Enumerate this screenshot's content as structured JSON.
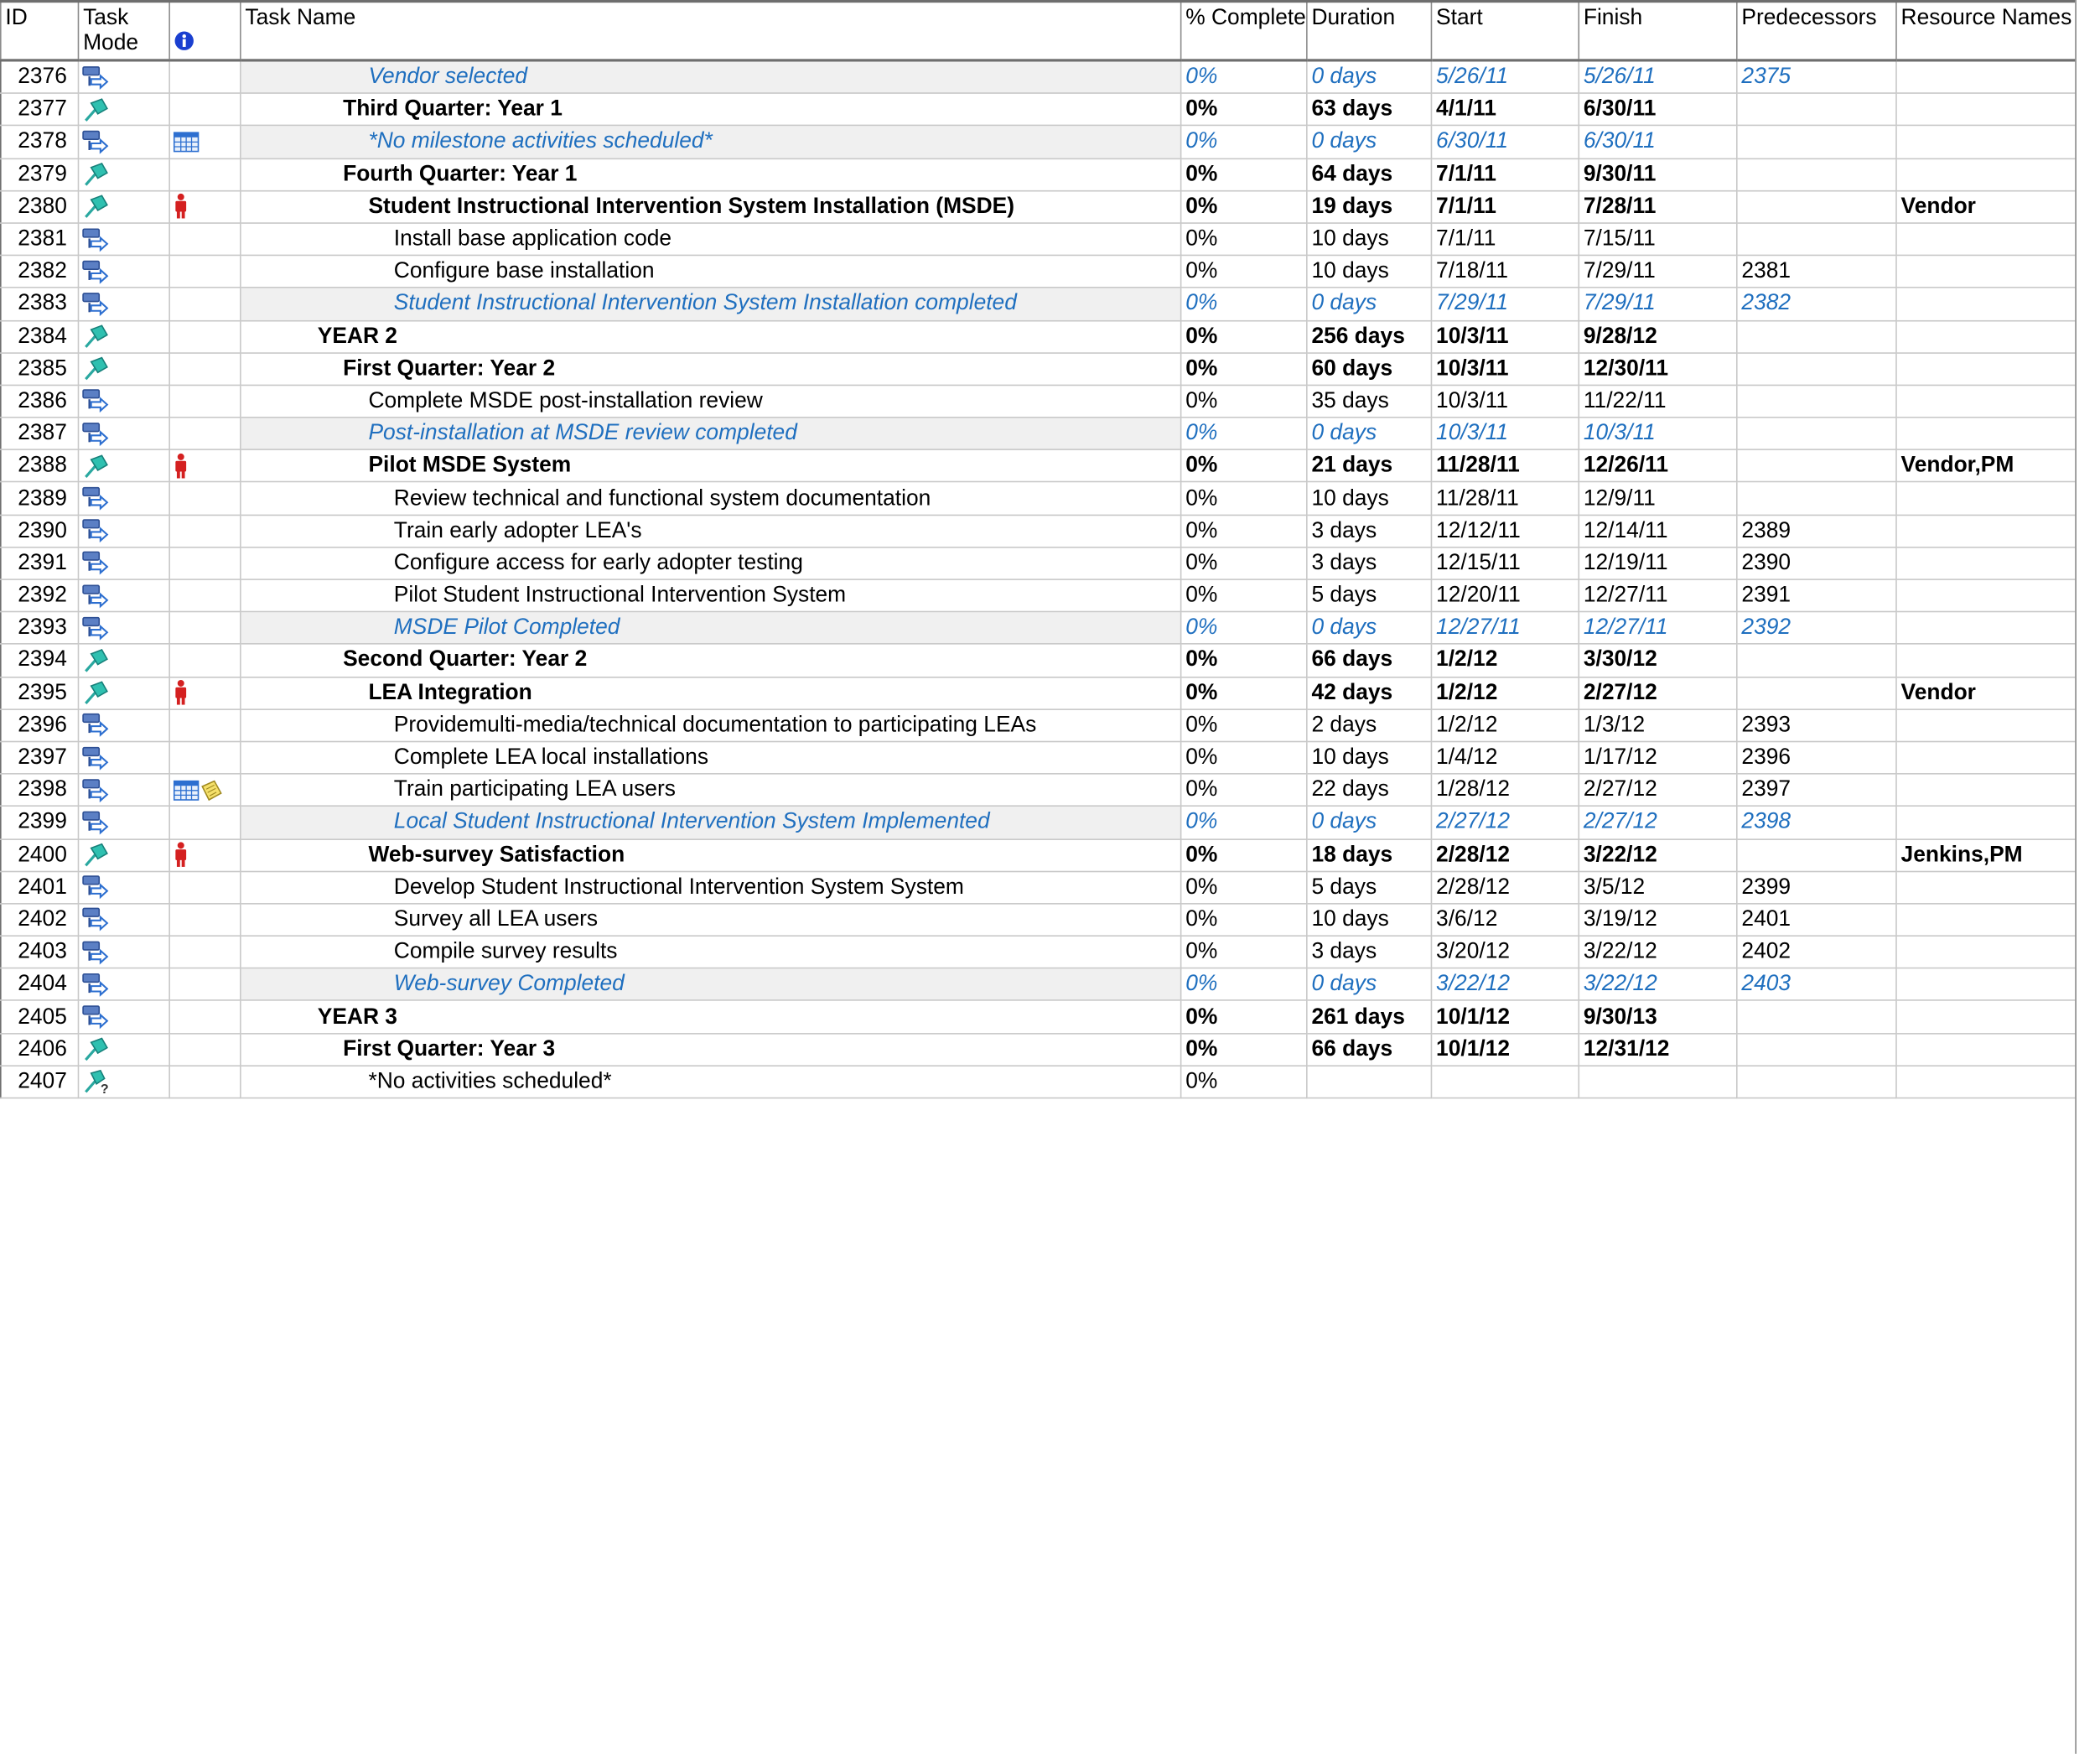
{
  "columns": {
    "id": "ID",
    "task_mode": "Task Mode",
    "task_name": "Task Name",
    "pct_complete": "% Complete",
    "duration": "Duration",
    "start": "Start",
    "finish": "Finish",
    "predecessors": "Predecessors",
    "resource_names": "Resource Names"
  },
  "colors": {
    "milestone_text": "#1f6fbf",
    "milestone_row_bg": "#f0f0f0",
    "resource_icon": "#d42020",
    "info_icon": "#1a3fd0"
  },
  "rows": [
    {
      "id": "2376",
      "mode": "auto",
      "indicators": [],
      "indent": 5,
      "type": "milestone",
      "name": "Vendor selected",
      "pct": "0%",
      "duration": "0 days",
      "start": "5/26/11",
      "finish": "5/26/11",
      "pred": "2375",
      "res": ""
    },
    {
      "id": "2377",
      "mode": "manual",
      "indicators": [],
      "indent": 4,
      "type": "summary",
      "name": "Third Quarter: Year 1",
      "pct": "0%",
      "duration": "63 days",
      "start": "4/1/11",
      "finish": "6/30/11",
      "pred": "",
      "res": ""
    },
    {
      "id": "2378",
      "mode": "auto",
      "indicators": [
        "calendar"
      ],
      "indent": 5,
      "type": "milestone",
      "name": "*No milestone activities scheduled*",
      "pct": "0%",
      "duration": "0 days",
      "start": "6/30/11",
      "finish": "6/30/11",
      "pred": "",
      "res": ""
    },
    {
      "id": "2379",
      "mode": "manual",
      "indicators": [],
      "indent": 4,
      "type": "summary",
      "name": "Fourth Quarter: Year 1",
      "pct": "0%",
      "duration": "64 days",
      "start": "7/1/11",
      "finish": "9/30/11",
      "pred": "",
      "res": ""
    },
    {
      "id": "2380",
      "mode": "manual",
      "indicators": [
        "resource"
      ],
      "indent": 5,
      "type": "summary",
      "name": "Student Instructional Intervention System Installation (MSDE)",
      "pct": "0%",
      "duration": "19 days",
      "start": "7/1/11",
      "finish": "7/28/11",
      "pred": "",
      "res": "Vendor"
    },
    {
      "id": "2381",
      "mode": "auto",
      "indicators": [],
      "indent": 6,
      "type": "task",
      "name": "Install base application code",
      "pct": "0%",
      "duration": "10 days",
      "start": "7/1/11",
      "finish": "7/15/11",
      "pred": "",
      "res": ""
    },
    {
      "id": "2382",
      "mode": "auto",
      "indicators": [],
      "indent": 6,
      "type": "task",
      "name": "Configure base installation",
      "pct": "0%",
      "duration": "10 days",
      "start": "7/18/11",
      "finish": "7/29/11",
      "pred": "2381",
      "res": ""
    },
    {
      "id": "2383",
      "mode": "auto",
      "indicators": [],
      "indent": 6,
      "type": "milestone",
      "name": "Student Instructional Intervention System Installation completed",
      "pct": "0%",
      "duration": "0 days",
      "start": "7/29/11",
      "finish": "7/29/11",
      "pred": "2382",
      "res": ""
    },
    {
      "id": "2384",
      "mode": "manual",
      "indicators": [],
      "indent": 3,
      "type": "summary",
      "name": "YEAR 2",
      "pct": "0%",
      "duration": "256 days",
      "start": "10/3/11",
      "finish": "9/28/12",
      "pred": "",
      "res": ""
    },
    {
      "id": "2385",
      "mode": "manual",
      "indicators": [],
      "indent": 4,
      "type": "summary",
      "name": "First Quarter: Year 2",
      "pct": "0%",
      "duration": "60 days",
      "start": "10/3/11",
      "finish": "12/30/11",
      "pred": "",
      "res": ""
    },
    {
      "id": "2386",
      "mode": "auto",
      "indicators": [],
      "indent": 5,
      "type": "task",
      "name": "Complete MSDE post-installation review",
      "pct": "0%",
      "duration": "35 days",
      "start": "10/3/11",
      "finish": "11/22/11",
      "pred": "",
      "res": ""
    },
    {
      "id": "2387",
      "mode": "auto",
      "indicators": [],
      "indent": 5,
      "type": "milestone",
      "name": "Post-installation at MSDE review completed",
      "pct": "0%",
      "duration": "0 days",
      "start": "10/3/11",
      "finish": "10/3/11",
      "pred": "",
      "res": ""
    },
    {
      "id": "2388",
      "mode": "manual",
      "indicators": [
        "resource"
      ],
      "indent": 5,
      "type": "summary",
      "name": "Pilot MSDE System",
      "pct": "0%",
      "duration": "21 days",
      "start": "11/28/11",
      "finish": "12/26/11",
      "pred": "",
      "res": "Vendor,PM"
    },
    {
      "id": "2389",
      "mode": "auto",
      "indicators": [],
      "indent": 6,
      "type": "task",
      "name": "Review technical and functional system documentation",
      "pct": "0%",
      "duration": "10 days",
      "start": "11/28/11",
      "finish": "12/9/11",
      "pred": "",
      "res": ""
    },
    {
      "id": "2390",
      "mode": "auto",
      "indicators": [],
      "indent": 6,
      "type": "task",
      "name": "Train early adopter LEA's",
      "pct": "0%",
      "duration": "3 days",
      "start": "12/12/11",
      "finish": "12/14/11",
      "pred": "2389",
      "res": ""
    },
    {
      "id": "2391",
      "mode": "auto",
      "indicators": [],
      "indent": 6,
      "type": "task",
      "name": "Configure access for early adopter testing",
      "pct": "0%",
      "duration": "3 days",
      "start": "12/15/11",
      "finish": "12/19/11",
      "pred": "2390",
      "res": ""
    },
    {
      "id": "2392",
      "mode": "auto",
      "indicators": [],
      "indent": 6,
      "type": "task",
      "name": "Pilot Student Instructional Intervention System",
      "pct": "0%",
      "duration": "5 days",
      "start": "12/20/11",
      "finish": "12/27/11",
      "pred": "2391",
      "res": ""
    },
    {
      "id": "2393",
      "mode": "auto",
      "indicators": [],
      "indent": 6,
      "type": "milestone",
      "name": "MSDE Pilot Completed",
      "pct": "0%",
      "duration": "0 days",
      "start": "12/27/11",
      "finish": "12/27/11",
      "pred": "2392",
      "res": ""
    },
    {
      "id": "2394",
      "mode": "manual",
      "indicators": [],
      "indent": 4,
      "type": "summary",
      "name": "Second Quarter: Year 2",
      "pct": "0%",
      "duration": "66 days",
      "start": "1/2/12",
      "finish": "3/30/12",
      "pred": "",
      "res": ""
    },
    {
      "id": "2395",
      "mode": "manual",
      "indicators": [
        "resource"
      ],
      "indent": 5,
      "type": "summary",
      "name": "LEA Integration",
      "pct": "0%",
      "duration": "42 days",
      "start": "1/2/12",
      "finish": "2/27/12",
      "pred": "",
      "res": "Vendor"
    },
    {
      "id": "2396",
      "mode": "auto",
      "indicators": [],
      "indent": 6,
      "type": "task",
      "name": "Providemulti-media/technical documentation to participating LEAs",
      "pct": "0%",
      "duration": "2 days",
      "start": "1/2/12",
      "finish": "1/3/12",
      "pred": "2393",
      "res": ""
    },
    {
      "id": "2397",
      "mode": "auto",
      "indicators": [],
      "indent": 6,
      "type": "task",
      "name": "Complete LEA local installations",
      "pct": "0%",
      "duration": "10 days",
      "start": "1/4/12",
      "finish": "1/17/12",
      "pred": "2396",
      "res": ""
    },
    {
      "id": "2398",
      "mode": "auto",
      "indicators": [
        "calendar",
        "note"
      ],
      "indent": 6,
      "type": "task",
      "name": "Train participating LEA users",
      "pct": "0%",
      "duration": "22 days",
      "start": "1/28/12",
      "finish": "2/27/12",
      "pred": "2397",
      "res": ""
    },
    {
      "id": "2399",
      "mode": "auto",
      "indicators": [],
      "indent": 6,
      "type": "milestone",
      "name": "Local Student Instructional Intervention System Implemented",
      "pct": "0%",
      "duration": "0 days",
      "start": "2/27/12",
      "finish": "2/27/12",
      "pred": "2398",
      "res": ""
    },
    {
      "id": "2400",
      "mode": "manual",
      "indicators": [
        "resource"
      ],
      "indent": 5,
      "type": "summary",
      "name": "Web-survey Satisfaction",
      "pct": "0%",
      "duration": "18 days",
      "start": "2/28/12",
      "finish": "3/22/12",
      "pred": "",
      "res": "Jenkins,PM"
    },
    {
      "id": "2401",
      "mode": "auto",
      "indicators": [],
      "indent": 6,
      "type": "task",
      "name": "Develop Student Instructional Intervention System System",
      "pct": "0%",
      "duration": "5 days",
      "start": "2/28/12",
      "finish": "3/5/12",
      "pred": "2399",
      "res": ""
    },
    {
      "id": "2402",
      "mode": "auto",
      "indicators": [],
      "indent": 6,
      "type": "task",
      "name": "Survey all LEA users",
      "pct": "0%",
      "duration": "10 days",
      "start": "3/6/12",
      "finish": "3/19/12",
      "pred": "2401",
      "res": ""
    },
    {
      "id": "2403",
      "mode": "auto",
      "indicators": [],
      "indent": 6,
      "type": "task",
      "name": "Compile survey results",
      "pct": "0%",
      "duration": "3 days",
      "start": "3/20/12",
      "finish": "3/22/12",
      "pred": "2402",
      "res": ""
    },
    {
      "id": "2404",
      "mode": "auto",
      "indicators": [],
      "indent": 6,
      "type": "milestone",
      "name": "Web-survey Completed",
      "pct": "0%",
      "duration": "0 days",
      "start": "3/22/12",
      "finish": "3/22/12",
      "pred": "2403",
      "res": ""
    },
    {
      "id": "2405",
      "mode": "auto",
      "indicators": [],
      "indent": 3,
      "type": "summary",
      "name": "YEAR 3",
      "pct": "0%",
      "duration": "261 days",
      "start": "10/1/12",
      "finish": "9/30/13",
      "pred": "",
      "res": ""
    },
    {
      "id": "2406",
      "mode": "manual",
      "indicators": [],
      "indent": 4,
      "type": "summary",
      "name": "First Quarter: Year 3",
      "pct": "0%",
      "duration": "66 days",
      "start": "10/1/12",
      "finish": "12/31/12",
      "pred": "",
      "res": ""
    },
    {
      "id": "2407",
      "mode": "manual-question",
      "indicators": [],
      "indent": 5,
      "type": "task",
      "name": "*No activities scheduled*",
      "pct": "0%",
      "duration": "",
      "start": "",
      "finish": "",
      "pred": "",
      "res": ""
    }
  ]
}
